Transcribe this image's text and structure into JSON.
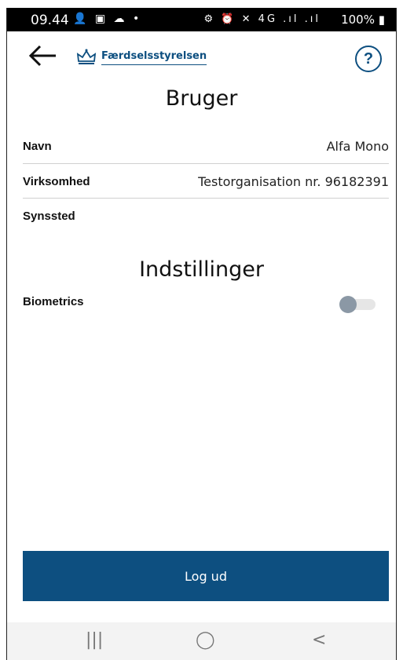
{
  "status_bar": {
    "time": "09.44",
    "left_icons": "👤 ▣ ☁ •",
    "right_icons": "⚙ ⏰ ✕ 4G .ıl .ıl",
    "battery": "100%"
  },
  "header": {
    "logo_text": "Færdselsstyrelsen",
    "help_label": "?"
  },
  "user_section": {
    "title": "Bruger",
    "rows": [
      {
        "label": "Navn",
        "value": "Alfa Mono"
      },
      {
        "label": "Virksomhed",
        "value": "Testorganisation nr. 96182391"
      },
      {
        "label": "Synssted",
        "value": ""
      }
    ]
  },
  "settings_section": {
    "title": "Indstillinger",
    "biometrics_label": "Biometrics",
    "biometrics_enabled": false
  },
  "logout_label": "Log ud",
  "nav": {
    "recents": "|||",
    "home": "◯",
    "back": "<"
  },
  "colors": {
    "brand": "#0d4f80",
    "toggle_knob_off": "#8b98a5"
  }
}
